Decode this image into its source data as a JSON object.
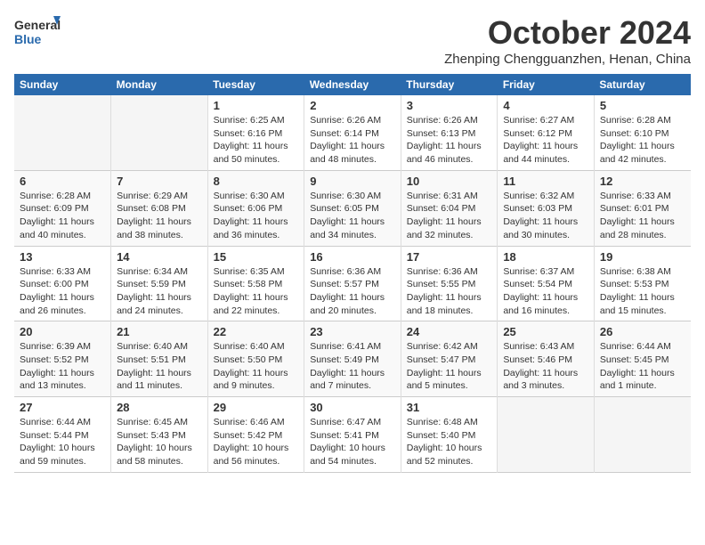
{
  "logo": {
    "line1": "General",
    "line2": "Blue"
  },
  "title": "October 2024",
  "location": "Zhenping Chengguanzhen, Henan, China",
  "days_of_week": [
    "Sunday",
    "Monday",
    "Tuesday",
    "Wednesday",
    "Thursday",
    "Friday",
    "Saturday"
  ],
  "weeks": [
    [
      {
        "num": "",
        "sunrise": "",
        "sunset": "",
        "daylight": ""
      },
      {
        "num": "",
        "sunrise": "",
        "sunset": "",
        "daylight": ""
      },
      {
        "num": "1",
        "sunrise": "Sunrise: 6:25 AM",
        "sunset": "Sunset: 6:16 PM",
        "daylight": "Daylight: 11 hours and 50 minutes."
      },
      {
        "num": "2",
        "sunrise": "Sunrise: 6:26 AM",
        "sunset": "Sunset: 6:14 PM",
        "daylight": "Daylight: 11 hours and 48 minutes."
      },
      {
        "num": "3",
        "sunrise": "Sunrise: 6:26 AM",
        "sunset": "Sunset: 6:13 PM",
        "daylight": "Daylight: 11 hours and 46 minutes."
      },
      {
        "num": "4",
        "sunrise": "Sunrise: 6:27 AM",
        "sunset": "Sunset: 6:12 PM",
        "daylight": "Daylight: 11 hours and 44 minutes."
      },
      {
        "num": "5",
        "sunrise": "Sunrise: 6:28 AM",
        "sunset": "Sunset: 6:10 PM",
        "daylight": "Daylight: 11 hours and 42 minutes."
      }
    ],
    [
      {
        "num": "6",
        "sunrise": "Sunrise: 6:28 AM",
        "sunset": "Sunset: 6:09 PM",
        "daylight": "Daylight: 11 hours and 40 minutes."
      },
      {
        "num": "7",
        "sunrise": "Sunrise: 6:29 AM",
        "sunset": "Sunset: 6:08 PM",
        "daylight": "Daylight: 11 hours and 38 minutes."
      },
      {
        "num": "8",
        "sunrise": "Sunrise: 6:30 AM",
        "sunset": "Sunset: 6:06 PM",
        "daylight": "Daylight: 11 hours and 36 minutes."
      },
      {
        "num": "9",
        "sunrise": "Sunrise: 6:30 AM",
        "sunset": "Sunset: 6:05 PM",
        "daylight": "Daylight: 11 hours and 34 minutes."
      },
      {
        "num": "10",
        "sunrise": "Sunrise: 6:31 AM",
        "sunset": "Sunset: 6:04 PM",
        "daylight": "Daylight: 11 hours and 32 minutes."
      },
      {
        "num": "11",
        "sunrise": "Sunrise: 6:32 AM",
        "sunset": "Sunset: 6:03 PM",
        "daylight": "Daylight: 11 hours and 30 minutes."
      },
      {
        "num": "12",
        "sunrise": "Sunrise: 6:33 AM",
        "sunset": "Sunset: 6:01 PM",
        "daylight": "Daylight: 11 hours and 28 minutes."
      }
    ],
    [
      {
        "num": "13",
        "sunrise": "Sunrise: 6:33 AM",
        "sunset": "Sunset: 6:00 PM",
        "daylight": "Daylight: 11 hours and 26 minutes."
      },
      {
        "num": "14",
        "sunrise": "Sunrise: 6:34 AM",
        "sunset": "Sunset: 5:59 PM",
        "daylight": "Daylight: 11 hours and 24 minutes."
      },
      {
        "num": "15",
        "sunrise": "Sunrise: 6:35 AM",
        "sunset": "Sunset: 5:58 PM",
        "daylight": "Daylight: 11 hours and 22 minutes."
      },
      {
        "num": "16",
        "sunrise": "Sunrise: 6:36 AM",
        "sunset": "Sunset: 5:57 PM",
        "daylight": "Daylight: 11 hours and 20 minutes."
      },
      {
        "num": "17",
        "sunrise": "Sunrise: 6:36 AM",
        "sunset": "Sunset: 5:55 PM",
        "daylight": "Daylight: 11 hours and 18 minutes."
      },
      {
        "num": "18",
        "sunrise": "Sunrise: 6:37 AM",
        "sunset": "Sunset: 5:54 PM",
        "daylight": "Daylight: 11 hours and 16 minutes."
      },
      {
        "num": "19",
        "sunrise": "Sunrise: 6:38 AM",
        "sunset": "Sunset: 5:53 PM",
        "daylight": "Daylight: 11 hours and 15 minutes."
      }
    ],
    [
      {
        "num": "20",
        "sunrise": "Sunrise: 6:39 AM",
        "sunset": "Sunset: 5:52 PM",
        "daylight": "Daylight: 11 hours and 13 minutes."
      },
      {
        "num": "21",
        "sunrise": "Sunrise: 6:40 AM",
        "sunset": "Sunset: 5:51 PM",
        "daylight": "Daylight: 11 hours and 11 minutes."
      },
      {
        "num": "22",
        "sunrise": "Sunrise: 6:40 AM",
        "sunset": "Sunset: 5:50 PM",
        "daylight": "Daylight: 11 hours and 9 minutes."
      },
      {
        "num": "23",
        "sunrise": "Sunrise: 6:41 AM",
        "sunset": "Sunset: 5:49 PM",
        "daylight": "Daylight: 11 hours and 7 minutes."
      },
      {
        "num": "24",
        "sunrise": "Sunrise: 6:42 AM",
        "sunset": "Sunset: 5:47 PM",
        "daylight": "Daylight: 11 hours and 5 minutes."
      },
      {
        "num": "25",
        "sunrise": "Sunrise: 6:43 AM",
        "sunset": "Sunset: 5:46 PM",
        "daylight": "Daylight: 11 hours and 3 minutes."
      },
      {
        "num": "26",
        "sunrise": "Sunrise: 6:44 AM",
        "sunset": "Sunset: 5:45 PM",
        "daylight": "Daylight: 11 hours and 1 minute."
      }
    ],
    [
      {
        "num": "27",
        "sunrise": "Sunrise: 6:44 AM",
        "sunset": "Sunset: 5:44 PM",
        "daylight": "Daylight: 10 hours and 59 minutes."
      },
      {
        "num": "28",
        "sunrise": "Sunrise: 6:45 AM",
        "sunset": "Sunset: 5:43 PM",
        "daylight": "Daylight: 10 hours and 58 minutes."
      },
      {
        "num": "29",
        "sunrise": "Sunrise: 6:46 AM",
        "sunset": "Sunset: 5:42 PM",
        "daylight": "Daylight: 10 hours and 56 minutes."
      },
      {
        "num": "30",
        "sunrise": "Sunrise: 6:47 AM",
        "sunset": "Sunset: 5:41 PM",
        "daylight": "Daylight: 10 hours and 54 minutes."
      },
      {
        "num": "31",
        "sunrise": "Sunrise: 6:48 AM",
        "sunset": "Sunset: 5:40 PM",
        "daylight": "Daylight: 10 hours and 52 minutes."
      },
      {
        "num": "",
        "sunrise": "",
        "sunset": "",
        "daylight": ""
      },
      {
        "num": "",
        "sunrise": "",
        "sunset": "",
        "daylight": ""
      }
    ]
  ]
}
